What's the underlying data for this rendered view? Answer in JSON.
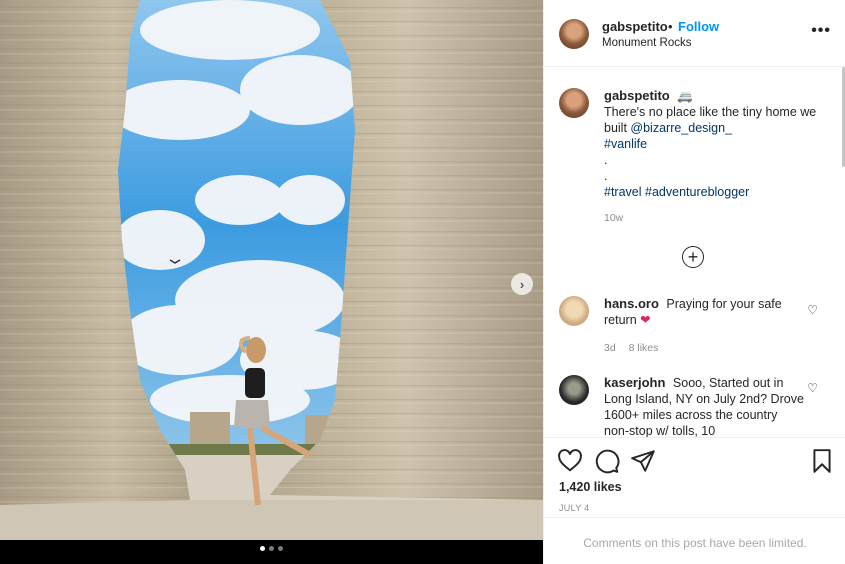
{
  "post": {
    "username": "gabspetito",
    "separator": "•",
    "follow_label": "Follow",
    "location": "Monument Rocks",
    "more_label": "•••"
  },
  "caption": {
    "username": "gabspetito",
    "emoji": "🚐",
    "line1": "There's no place like the tiny home we built ",
    "mention": "@bizarre_design_",
    "hashtag1": "#vanlife",
    "dot1": ".",
    "dot2": ".",
    "hashtag2": "#travel",
    "hashtag3": "#adventureblogger",
    "age": "10w"
  },
  "comments": [
    {
      "username": "hans.oro",
      "text": "Praying for your safe return ",
      "emoji": "❤",
      "age": "3d",
      "likes": "8 likes"
    },
    {
      "username": "kaserjohn",
      "text": "Sooo, Started out in Long Island, NY on July 2nd? Drove 1600+ miles across the country non-stop w/ tolls, 10"
    }
  ],
  "stats": {
    "likes": "1,420 likes",
    "date": "JULY 4"
  },
  "footer": {
    "limited_text": "Comments on this post have been limited."
  },
  "icons": {
    "like": "heart-icon",
    "comment": "comment-icon",
    "share": "share-icon",
    "save": "bookmark-icon",
    "add": "add-comment-icon",
    "next": "chevron-right-icon"
  },
  "carousel": {
    "total": 3,
    "active": 1
  }
}
